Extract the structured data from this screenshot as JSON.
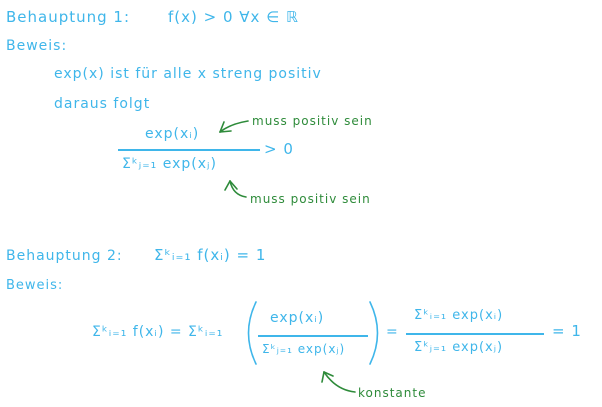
{
  "claim1": {
    "title": "Behauptung 1:",
    "statement": "f(x) > 0  ∀x ∈ ℝ",
    "proof_label": "Beweis:",
    "line1": "exp(x)  ist  für  alle  x  streng  positiv",
    "line2": "daraus folgt",
    "numerator": "exp(xᵢ)",
    "denominator": "Σᵏⱼ₌₁  exp(xⱼ)",
    "relation": "> 0",
    "note_numerator": "muss positiv sein",
    "note_denominator": "muss positiv sein"
  },
  "claim2": {
    "title": "Behauptung 2:",
    "statement": "Σᵏᵢ₌₁ f(xᵢ)  = 1",
    "proof_label": "Beweis:",
    "lhs": "Σᵏᵢ₌₁ f(xᵢ)  =  Σᵏᵢ₌₁",
    "mid_numerator": "exp(xᵢ)",
    "mid_denominator": "Σᵏⱼ₌₁  exp(xⱼ)",
    "equals": "=",
    "right_numerator": "Σᵏᵢ₌₁  exp(xᵢ)",
    "right_denominator": "Σᵏⱼ₌₁  exp(xⱼ)",
    "result": "=  1",
    "note_constant": "konstante"
  },
  "colors": {
    "ink": "#3fb6ea",
    "annotation": "#2e8b3a"
  }
}
